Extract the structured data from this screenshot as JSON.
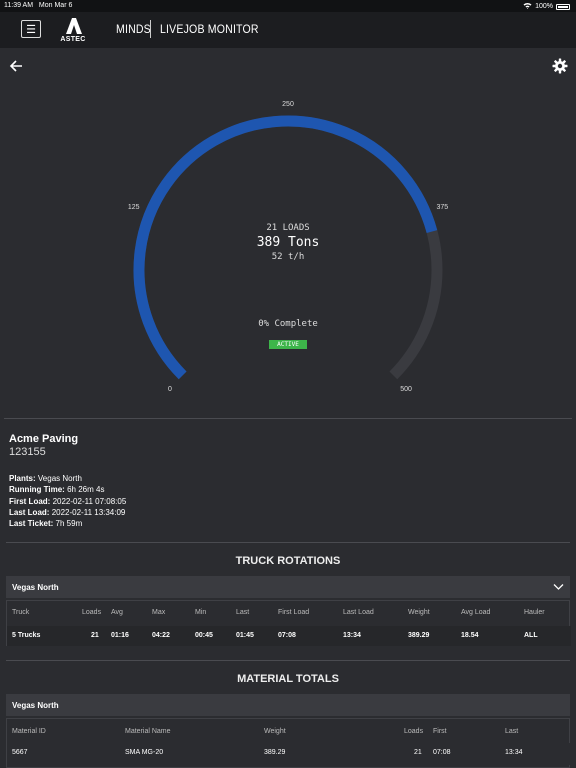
{
  "status_bar": {
    "time": "11:39 AM",
    "date": "Mon Mar 6",
    "battery": "100%"
  },
  "navbar": {
    "logo_text": "ASTEC",
    "brand": "MINDS",
    "title": "LIVEJOB MONITOR"
  },
  "icons": {
    "menu": "menu-icon",
    "back": "back-arrow-icon",
    "settings": "gear-icon",
    "chevron": "chevron-down-icon"
  },
  "gauge": {
    "loads": "21 LOADS",
    "tons": "389 Tons",
    "rate": "52 t/h",
    "complete": "0% Complete",
    "status": "ACTIVE",
    "scale_labels": [
      "0",
      "125",
      "250",
      "375",
      "500"
    ],
    "max": 500,
    "value": 389,
    "colors": {
      "fill": "#1e56b0",
      "track": "#3a3b40",
      "status": "#3db54a"
    }
  },
  "job": {
    "company": "Acme Paving",
    "number": "123155",
    "details": [
      {
        "label": "Plants:",
        "value": "Vegas North"
      },
      {
        "label": "Running Time:",
        "value": "6h 26m 4s"
      },
      {
        "label": "First Load:",
        "value": "2022-02-11 07:08:05"
      },
      {
        "label": "Last Load:",
        "value": "2022-02-11 13:34:09"
      },
      {
        "label": "Last Ticket:",
        "value": "7h 59m"
      }
    ]
  },
  "truck_rotations": {
    "title": "TRUCK ROTATIONS",
    "plant": "Vegas North",
    "headers": [
      "Truck",
      "Loads",
      "Avg",
      "Max",
      "Min",
      "Last",
      "First Load",
      "Last Load",
      "Weight",
      "Avg Load",
      "Hauler"
    ],
    "row": [
      "5 Trucks",
      "21",
      "01:16",
      "04:22",
      "00:45",
      "01:45",
      "07:08",
      "13:34",
      "389.29",
      "18.54",
      "ALL"
    ]
  },
  "material_totals": {
    "title": "MATERIAL TOTALS",
    "plant": "Vegas North",
    "headers": [
      "Material ID",
      "Material Name",
      "Weight",
      "Loads",
      "First",
      "Last"
    ],
    "row": [
      "5667",
      "SMA MG-20",
      "389.29",
      "21",
      "07:08",
      "13:34"
    ]
  }
}
